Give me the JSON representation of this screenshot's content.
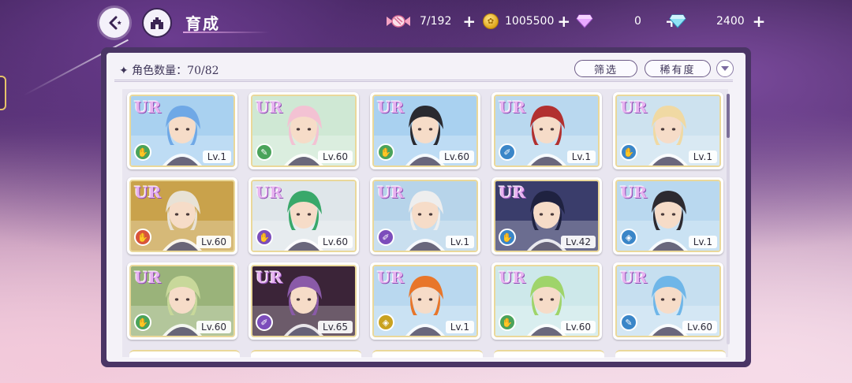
{
  "header": {
    "title": "育成",
    "back_icon": "back-arrow-icon",
    "home_icon": "castle-icon"
  },
  "resources": [
    {
      "icon": "candy-icon",
      "value": "7/192"
    },
    {
      "icon": "gold-coin-icon",
      "value": "1005500"
    },
    {
      "icon": "pink-gem-icon",
      "value": "0"
    },
    {
      "icon": "blue-diamond-icon",
      "value": "2400"
    }
  ],
  "plus_label": "+",
  "panel": {
    "count_label": "✦ 角色数量：70/82",
    "filter_button": "筛选",
    "rarity_button": "稀有度"
  },
  "colors": {
    "green": "#4aa35a",
    "blue": "#3a86c8",
    "red": "#d9543a",
    "purple": "#7c4dbb",
    "yellow": "#c9a21f"
  },
  "cards": [
    {
      "rarity": "UR",
      "type": "green",
      "type_glyph": "✋",
      "level": "Lv.1",
      "hair": "#6fa8e6",
      "bg": "#a9d1f0"
    },
    {
      "rarity": "UR",
      "type": "green",
      "type_glyph": "✎",
      "level": "Lv.60",
      "hair": "#f3c2d3",
      "bg": "#cfe8d4"
    },
    {
      "rarity": "UR",
      "type": "green",
      "type_glyph": "✋",
      "level": "Lv.60",
      "hair": "#2a2a30",
      "bg": "#a9d1f0"
    },
    {
      "rarity": "UR",
      "type": "blue",
      "type_glyph": "✐",
      "level": "Lv.1",
      "hair": "#b2302f",
      "bg": "#b9d8ef"
    },
    {
      "rarity": "UR",
      "type": "blue",
      "type_glyph": "✋",
      "level": "Lv.1",
      "hair": "#f0d9a3",
      "bg": "#cde2ef"
    },
    {
      "rarity": "UR",
      "type": "red",
      "type_glyph": "✋",
      "level": "Lv.60",
      "hair": "#e8e2d6",
      "bg": "#c9a24b"
    },
    {
      "rarity": "UR",
      "type": "purple",
      "type_glyph": "✋",
      "level": "Lv.60",
      "hair": "#39a86a",
      "bg": "#dfe6ea"
    },
    {
      "rarity": "UR",
      "type": "purple",
      "type_glyph": "✐",
      "level": "Lv.1",
      "hair": "#eeeeee",
      "bg": "#b7d4ea"
    },
    {
      "rarity": "UR",
      "type": "blue",
      "type_glyph": "✋",
      "level": "Lv.42",
      "hair": "#1f2240",
      "bg": "#3a3d6b"
    },
    {
      "rarity": "UR",
      "type": "blue",
      "type_glyph": "◈",
      "level": "Lv.1",
      "hair": "#2d2a30",
      "bg": "#b9d8ef"
    },
    {
      "rarity": "UR",
      "type": "green",
      "type_glyph": "✋",
      "level": "Lv.60",
      "hair": "#c8d89a",
      "bg": "#9ab37a"
    },
    {
      "rarity": "UR",
      "type": "purple",
      "type_glyph": "✐",
      "level": "Lv.65",
      "hair": "#8a5aa8",
      "bg": "#3b2438"
    },
    {
      "rarity": "UR",
      "type": "yellow",
      "type_glyph": "◈",
      "level": "Lv.1",
      "hair": "#e8762a",
      "bg": "#b9d8ef"
    },
    {
      "rarity": "UR",
      "type": "green",
      "type_glyph": "✋",
      "level": "Lv.60",
      "hair": "#9fd46a",
      "bg": "#cde8ea"
    },
    {
      "rarity": "UR",
      "type": "blue",
      "type_glyph": "✎",
      "level": "Lv.60",
      "hair": "#6fb6e8",
      "bg": "#c6dff0"
    }
  ]
}
